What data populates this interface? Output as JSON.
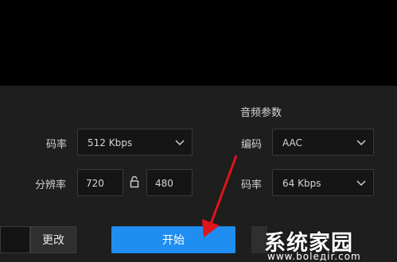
{
  "video": {
    "bitrate_label": "码率",
    "bitrate_value": "512 Kbps",
    "resolution_label": "分辨率",
    "width": "720",
    "height": "480"
  },
  "audio": {
    "section_title": "音频参数",
    "codec_label": "编码",
    "codec_value": "AAC",
    "bitrate_label": "码率",
    "bitrate_value": "64 Kbps"
  },
  "footer": {
    "change_label": "更改",
    "start_label": "开始"
  },
  "watermark": {
    "main": "系统家园",
    "sub": "www.bolедir.com"
  },
  "colors": {
    "accent": "#1f8ef0",
    "arrow": "#e0141c"
  },
  "icons": [
    "chevron-down-icon",
    "lock-icon",
    "arrow-annotation"
  ]
}
